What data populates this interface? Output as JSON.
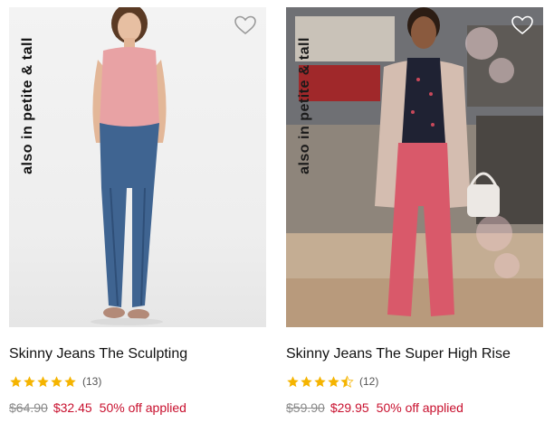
{
  "products": [
    {
      "badge": "also in petite & tall",
      "name": "Skinny Jeans The Sculpting",
      "rating": 5,
      "review_count": "(13)",
      "was_price": "$64.90",
      "price": "$32.45",
      "promo": "50% off applied",
      "icons": {
        "favorite": "heart-outline-icon",
        "star": "star-icon"
      }
    },
    {
      "badge": "also in petite & tall",
      "name": "Skinny Jeans The Super High Rise",
      "rating": 4.5,
      "review_count": "(12)",
      "was_price": "$59.90",
      "price": "$29.95",
      "promo": "50% off applied",
      "icons": {
        "favorite": "heart-outline-icon",
        "star": "star-icon"
      }
    }
  ],
  "colors": {
    "sale": "#c8102e",
    "star": "#f5b400",
    "strike": "#8a8a8a"
  }
}
